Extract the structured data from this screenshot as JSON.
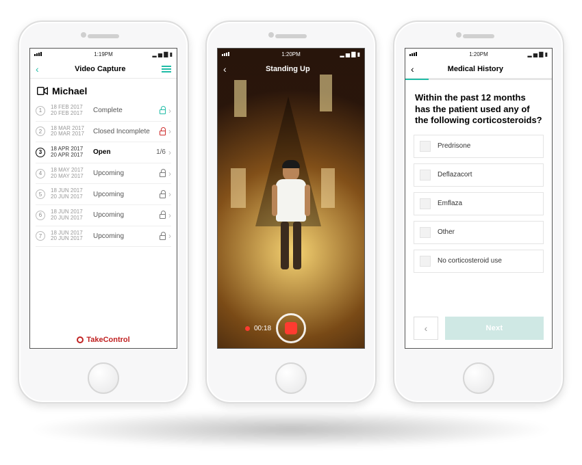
{
  "screen1": {
    "time": "1:19PM",
    "title": "Video Capture",
    "patient": "Michael",
    "brand": "TakeControl",
    "sessions": [
      {
        "num": "1",
        "date1": "18 FEB 2017",
        "date2": "20 FEB 2017",
        "status": "Complete",
        "lock": "green",
        "progress": "",
        "open": false
      },
      {
        "num": "2",
        "date1": "18 MAR 2017",
        "date2": "20 MAR 2017",
        "status": "Closed Incomplete",
        "lock": "red",
        "progress": "",
        "open": false
      },
      {
        "num": "3",
        "date1": "18 APR 2017",
        "date2": "20 APR 2017",
        "status": "Open",
        "lock": "",
        "progress": "1/6",
        "open": true
      },
      {
        "num": "4",
        "date1": "18 MAY 2017",
        "date2": "20 MAY 2017",
        "status": "Upcoming",
        "lock": "closed",
        "progress": "",
        "open": false
      },
      {
        "num": "5",
        "date1": "18 JUN 2017",
        "date2": "20 JUN 2017",
        "status": "Upcoming",
        "lock": "closed",
        "progress": "",
        "open": false
      },
      {
        "num": "6",
        "date1": "18 JUN 2017",
        "date2": "20 JUN 2017",
        "status": "Upcoming",
        "lock": "closed",
        "progress": "",
        "open": false
      },
      {
        "num": "7",
        "date1": "18 JUN 2017",
        "date2": "20 JUN 2017",
        "status": "Upcoming",
        "lock": "closed",
        "progress": "",
        "open": false
      }
    ]
  },
  "screen2": {
    "time": "1:20PM",
    "title": "Standing Up",
    "elapsed": "00:18"
  },
  "screen3": {
    "time": "1:20PM",
    "title": "Medical History",
    "question": "Within the past 12 months has the patient used any of the following corticosteroids?",
    "options": [
      "Predrisone",
      "Deflazacort",
      "Emflaza",
      "Other",
      "No corticosteroid use"
    ],
    "prev": "‹",
    "next": "Next"
  }
}
